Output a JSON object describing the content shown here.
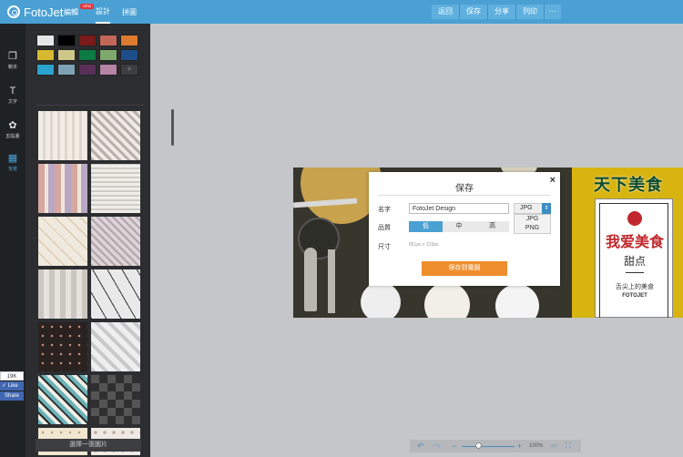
{
  "app": {
    "name": "FotoJet"
  },
  "topnav": {
    "edit": "編輯",
    "new_badge": "NEW",
    "design": "設計",
    "collage": "拼圖"
  },
  "toolbar": {
    "back": "返回",
    "save": "保存",
    "share": "分享",
    "print": "列印",
    "more": "···"
  },
  "rail": {
    "templates": "範本",
    "text": "文字",
    "clipart": "剪貼畫",
    "background": "背景"
  },
  "colors": [
    "#e6e6e6",
    "#000000",
    "#7a1a1a",
    "#c2665a",
    "#dd7a30",
    "#d6b92f",
    "#cfc78a",
    "#0b7a45",
    "#7fa86d",
    "#1d4e8a",
    "#2aa3cf",
    "#7ea2b5",
    "#5a2f5a",
    "#b783a6"
  ],
  "panel": {
    "add_color": "+",
    "choose_image": "選擇一張圖片"
  },
  "social": {
    "count": "19K",
    "like": "✓ Like",
    "share": "Share"
  },
  "canvas": {
    "banner_title": "天下美食",
    "card_title": "我爱美食",
    "card_sub": "甜点",
    "card_tagline": "舌尖上的美食",
    "card_brand": "FOTOJET"
  },
  "dialog": {
    "title": "保存",
    "close": "×",
    "name_label": "名字",
    "name_value": "FotoJet Design",
    "format_selected": "JPG",
    "format_options": [
      "JPG",
      "PNG"
    ],
    "quality_label": "品質",
    "quality_options": [
      "低",
      "中",
      "高"
    ],
    "quality_selected": "低",
    "size_label": "尺寸",
    "size_value": "851px x 315px",
    "save_button": "保存到電腦"
  },
  "zoom": {
    "percent": "100%"
  }
}
